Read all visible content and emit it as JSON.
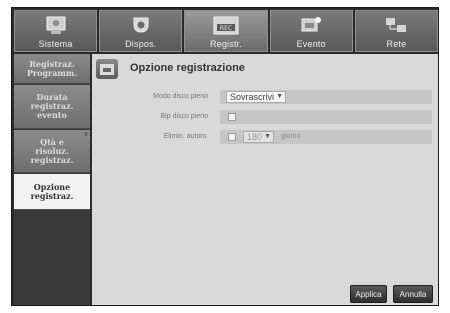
{
  "tabs": [
    {
      "label": "Sistema",
      "icon": "system-monitor-icon",
      "active": false
    },
    {
      "label": "Dispos.",
      "icon": "camera-icon",
      "active": false
    },
    {
      "label": "Registr.",
      "icon": "rec-icon",
      "badge": "REC",
      "active": true
    },
    {
      "label": "Evento",
      "icon": "event-icon",
      "active": false
    },
    {
      "label": "Rete",
      "icon": "network-icon",
      "active": false
    }
  ],
  "sidebar": {
    "items": [
      {
        "label": "Registraz.\nProgramm.",
        "active": false
      },
      {
        "label": "Durata\nregistraz.\nevento",
        "active": false
      },
      {
        "label": "Qtà e\nrisoluz.\nregistraz.",
        "active": false,
        "mark": "x"
      },
      {
        "label": "Opzione\nregistraz.",
        "active": true
      }
    ]
  },
  "main": {
    "title": "Opzione registrazione",
    "rows": {
      "disk_full_mode": {
        "label": "Modo disco pieno",
        "value": "Sovrascrivi"
      },
      "disk_full_beep": {
        "label": "Bip disco pieno",
        "checked": false
      },
      "auto_delete": {
        "label": "Elimin. autom.",
        "checked": false,
        "value": "180",
        "unit": "giorno"
      }
    }
  },
  "buttons": {
    "apply": "Applica",
    "cancel": "Annulla"
  }
}
